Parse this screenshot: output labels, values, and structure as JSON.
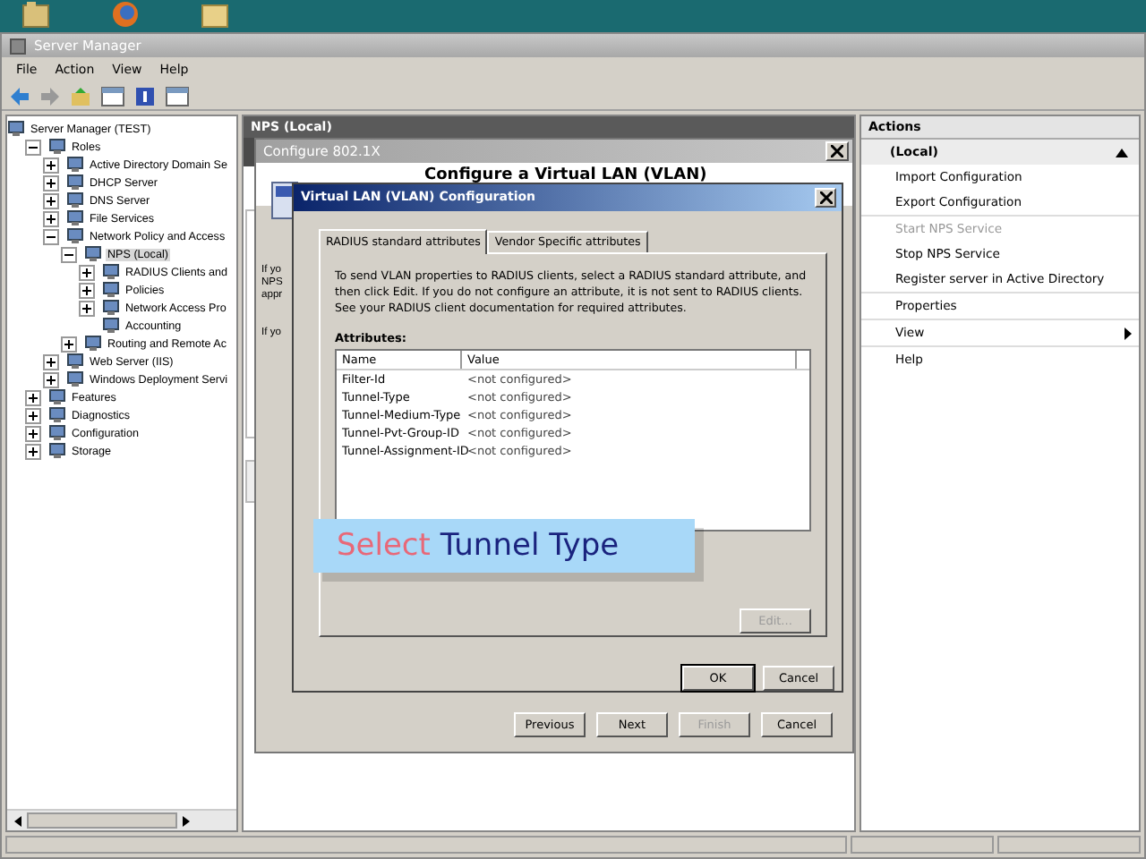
{
  "app": {
    "title": "Server Manager",
    "menu": [
      "File",
      "Action",
      "View",
      "Help"
    ]
  },
  "tree": {
    "label": "Server Manager (TEST)",
    "selected": false,
    "children": [
      {
        "label": "Roles",
        "expanded": true,
        "selected": false,
        "children": [
          {
            "label": "Active Directory Domain Se",
            "expanded": false,
            "selected": false
          },
          {
            "label": "DHCP Server",
            "expanded": false,
            "selected": false
          },
          {
            "label": "DNS Server",
            "expanded": false,
            "selected": false
          },
          {
            "label": "File Services",
            "expanded": false,
            "selected": false
          },
          {
            "label": "Network Policy and Access",
            "expanded": true,
            "selected": false,
            "children": [
              {
                "label": "NPS (Local)",
                "expanded": true,
                "selected": true,
                "children": [
                  {
                    "label": "RADIUS Clients and",
                    "expanded": false,
                    "selected": false
                  },
                  {
                    "label": "Policies",
                    "expanded": false,
                    "selected": false
                  },
                  {
                    "label": "Network Access Pro",
                    "expanded": false,
                    "selected": false
                  },
                  {
                    "label": "Accounting",
                    "selected": false
                  }
                ]
              },
              {
                "label": "Routing and Remote Ac",
                "expanded": false,
                "selected": false
              }
            ]
          },
          {
            "label": "Web Server (IIS)",
            "expanded": false,
            "selected": false
          },
          {
            "label": "Windows Deployment Servi",
            "expanded": false,
            "selected": false
          }
        ]
      },
      {
        "label": "Features",
        "expanded": false,
        "selected": false
      },
      {
        "label": "Diagnostics",
        "expanded": false,
        "selected": false
      },
      {
        "label": "Configuration",
        "expanded": false,
        "selected": false
      },
      {
        "label": "Storage",
        "expanded": false,
        "selected": false
      }
    ]
  },
  "center": {
    "header": "NPS (Local)"
  },
  "actions": {
    "header": "Actions",
    "section": "(Local)",
    "items": [
      {
        "label": "Import Configuration",
        "kind": "item",
        "disabled": false,
        "separator_after": false
      },
      {
        "label": "Export Configuration",
        "kind": "item",
        "disabled": false,
        "separator_after": true
      },
      {
        "label": "Start NPS Service",
        "kind": "item",
        "disabled": true,
        "separator_after": false
      },
      {
        "label": "Stop NPS Service",
        "kind": "item",
        "disabled": false,
        "separator_after": false
      },
      {
        "label": "Register server in Active Directory",
        "kind": "item",
        "disabled": false,
        "separator_after": true
      },
      {
        "label": "Properties",
        "kind": "item",
        "disabled": false,
        "separator_after": true
      },
      {
        "label": "View",
        "kind": "submenu",
        "disabled": false,
        "separator_after": true
      },
      {
        "label": "Help",
        "kind": "item",
        "disabled": false,
        "separator_after": false
      }
    ]
  },
  "wizard": {
    "title": "Configure 802.1X",
    "heading": "Configure a Virtual LAN (VLAN)",
    "fragments": [
      "If yo",
      "NPS",
      "appr",
      "If yo"
    ],
    "buttons": [
      {
        "label": "Previous",
        "disabled": false
      },
      {
        "label": "Next",
        "disabled": false
      },
      {
        "label": "Finish",
        "disabled": true
      },
      {
        "label": "Cancel",
        "disabled": false
      }
    ]
  },
  "vlan_dialog": {
    "title": "Virtual LAN (VLAN) Configuration",
    "tabs": [
      {
        "label": "RADIUS standard attributes",
        "selected": true
      },
      {
        "label": "Vendor Specific attributes",
        "selected": false
      }
    ],
    "description": "To send VLAN properties to RADIUS clients, select a RADIUS standard attribute, and then click Edit. If you do not configure an attribute, it is not sent to RADIUS clients. See your RADIUS client documentation for required attributes.",
    "attributes_label": "Attributes:",
    "columns": [
      "Name",
      "Value"
    ],
    "rows": [
      {
        "name": "Filter-Id",
        "value": "<not configured>",
        "selected": false
      },
      {
        "name": "Tunnel-Type",
        "value": "<not configured>",
        "selected": false
      },
      {
        "name": "Tunnel-Medium-Type",
        "value": "<not configured>",
        "selected": false
      },
      {
        "name": "Tunnel-Pvt-Group-ID",
        "value": "<not configured>",
        "selected": false
      },
      {
        "name": "Tunnel-Assignment-ID",
        "value": "<not configured>",
        "selected": false
      }
    ],
    "edit_button": {
      "label": "Edit...",
      "disabled": true
    },
    "buttons": [
      {
        "label": "OK",
        "default": true
      },
      {
        "label": "Cancel",
        "default": false
      }
    ]
  },
  "caption": {
    "highlight": "Select",
    "text": "Tunnel Type"
  }
}
